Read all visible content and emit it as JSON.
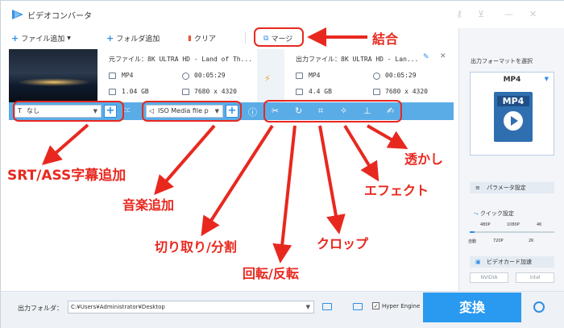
{
  "app": {
    "title": "ビデオコンバータ"
  },
  "toolbar": {
    "add_file": "ファイル追加",
    "add_folder": "フォルダ追加",
    "clear": "クリア",
    "merge": "マージ"
  },
  "source": {
    "file_label": "元ファイル：",
    "file_name": "8K ULTRA HD - Land of Th...",
    "format": "MP4",
    "duration": "00:05:29",
    "size": "1.04 GB",
    "resolution": "7680 x 4320"
  },
  "output": {
    "file_label": "出力ファイル：",
    "file_name": "8K ULTRA HD - Lan...",
    "format": "MP4",
    "duration": "00:05:29",
    "size": "4.4 GB",
    "resolution": "7680 x 4320"
  },
  "editbar": {
    "subtitle_value": "なし",
    "audio_value": "ISO Media file p",
    "cc": "CC"
  },
  "annotations": {
    "merge": "結合",
    "subtitle": "SRT/ASS字幕追加",
    "audio": "音楽追加",
    "cut": "切り取り/分割",
    "rotate": "回転/反転",
    "crop": "クロップ",
    "effect": "エフェクト",
    "watermark": "透かし"
  },
  "right_panel": {
    "title": "出力フォーマットを選択",
    "format": "MP4",
    "card_label": "MP4",
    "params": "パラメータ設定",
    "quick": "クイック設定",
    "quick_top": [
      "480P",
      "1080P",
      "4K"
    ],
    "quick_bottom": [
      "自動",
      "720P",
      "2K"
    ],
    "gpu": "ビデオカード加速",
    "nvidia": "NVIDIA",
    "intel": "intel"
  },
  "bottom": {
    "folder_label": "出力フォルダ：",
    "folder_path": "C:¥Users¥Administrator¥Desktop",
    "hyper": "Hyper Engine",
    "convert": "変換"
  },
  "colors": {
    "accent": "#2a9af0",
    "annotation": "#e8281f",
    "editbar": "#5aace6"
  }
}
